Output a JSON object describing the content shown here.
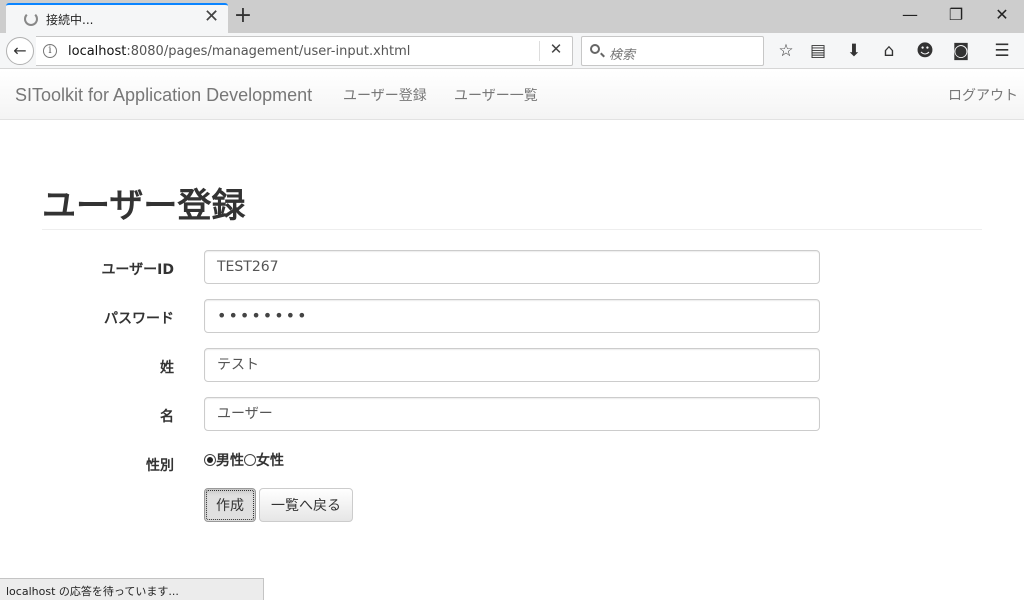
{
  "browser": {
    "tab_title": "接続中...",
    "tab_close": "✕",
    "new_tab": "+",
    "window": {
      "minimize": "—",
      "restore": "❐",
      "close": "✕"
    },
    "back": "←",
    "url_host": "localhost",
    "url_rest": ":8080/pages/management/user-input.xhtml",
    "stop": "✕",
    "search_placeholder": "検索",
    "toolbar_icons": [
      "star-icon",
      "reader-icon",
      "download-icon",
      "home-icon",
      "smiley-icon",
      "pocket-icon",
      "menu-icon"
    ],
    "status_text": "localhost の応答を待っています..."
  },
  "app_nav": {
    "brand": "SIToolkit for Application Development",
    "links": [
      "ユーザー登録",
      "ユーザー一覧"
    ],
    "logout": "ログアウト"
  },
  "page": {
    "title": "ユーザー登録"
  },
  "form": {
    "user_id": {
      "label": "ユーザーID",
      "value": "TEST267"
    },
    "password": {
      "label": "パスワード",
      "value": "••••••••"
    },
    "last_name": {
      "label": "姓",
      "value": "テスト"
    },
    "first_name": {
      "label": "名",
      "value": "ユーザー"
    },
    "gender": {
      "label": "性別",
      "options": [
        "男性",
        "女性"
      ],
      "selected": "男性"
    },
    "create_button": "作成",
    "back_button": "一覧へ戻る"
  }
}
